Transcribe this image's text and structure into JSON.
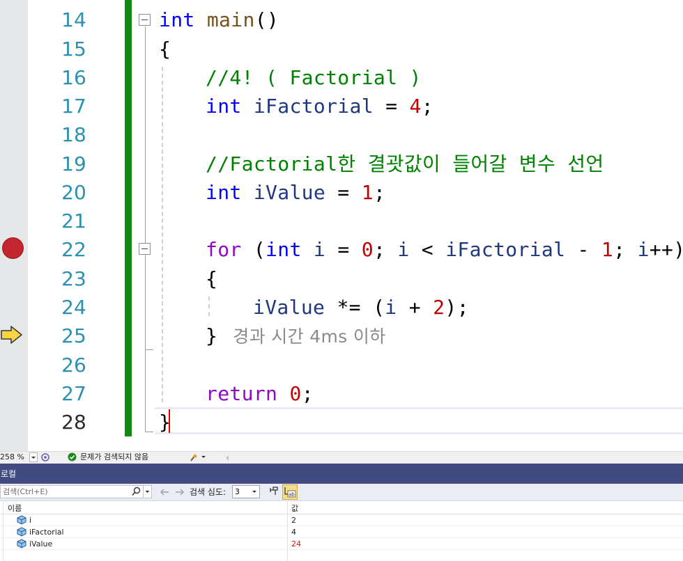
{
  "editor": {
    "line_numbers": [
      "14",
      "15",
      "16",
      "17",
      "18",
      "19",
      "20",
      "21",
      "22",
      "23",
      "24",
      "25",
      "26",
      "27",
      "28"
    ],
    "current_line_number": "28",
    "code": {
      "l14": {
        "kw": "int",
        "sp": " ",
        "fn": "main",
        "rest": "()"
      },
      "l15": {
        "text": "{"
      },
      "l16": {
        "comment": "//4! ( Factorial )"
      },
      "l17": {
        "kw": "int",
        "var": "iFactorial",
        "op": " = ",
        "num": "4",
        "end": ";"
      },
      "l19": {
        "comment": "//Factorial한 결괏값이 들어갈 변수 선언"
      },
      "l20": {
        "kw": "int",
        "var": "iValue",
        "op": " = ",
        "num": "1",
        "end": ";"
      },
      "l22": {
        "ctl": "for",
        "p1": " (",
        "kw": "int",
        "v1": "i",
        "op1": " = ",
        "n1": "0",
        "p2": "; ",
        "v2": "i",
        "op2": " < ",
        "v3": "iFactorial",
        "op3": " - ",
        "n2": "1",
        "p3": "; ",
        "v4": "i",
        "p4": "++)"
      },
      "l23": {
        "text": "{"
      },
      "l24": {
        "v1": "iValue",
        "op1": " *= (",
        "v2": "i",
        "op2": " + ",
        "num": "2",
        "end": ");"
      },
      "l25": {
        "brace": "}",
        "hint": "경과 시간 4ms 이하"
      },
      "l27": {
        "ctl": "return",
        "sp": " ",
        "num": "0",
        "end": ";"
      },
      "l28": {
        "text": "}"
      }
    }
  },
  "statusbar": {
    "zoom": "258 %",
    "issues": "문제가 검색되지 않음"
  },
  "locals": {
    "title": "로컬",
    "search_placeholder": "검색(Ctrl+E)",
    "depth_label": "검색 심도:",
    "depth_value": "3",
    "columns": {
      "name": "이름",
      "value": "값"
    },
    "rows": [
      {
        "name": "i",
        "value": "2",
        "changed": false
      },
      {
        "name": "iFactorial",
        "value": "4",
        "changed": false
      },
      {
        "name": "iValue",
        "value": "24",
        "changed": true
      }
    ]
  },
  "colors": {
    "keyword": "#0000ff",
    "control_keyword": "#8f08c4",
    "function": "#74531f",
    "variable": "#1f377f",
    "number": "#c00000",
    "comment": "#008000",
    "line_number": "#2b91af",
    "breakpoint": "#c3262e",
    "exec_arrow": "#f9d43f",
    "change_bar": "#108a10",
    "title_bar": "#424b80",
    "changed_value": "#e51400"
  },
  "icons": [
    "breakpoint-icon",
    "execution-pointer-icon",
    "collapse-icon",
    "zoom-dropdown-icon",
    "check-ok-icon",
    "cleanup-brush-icon",
    "search-icon",
    "back-arrow-icon",
    "forward-arrow-icon",
    "pin-icon",
    "ab-icon",
    "local-variable-icon"
  ]
}
